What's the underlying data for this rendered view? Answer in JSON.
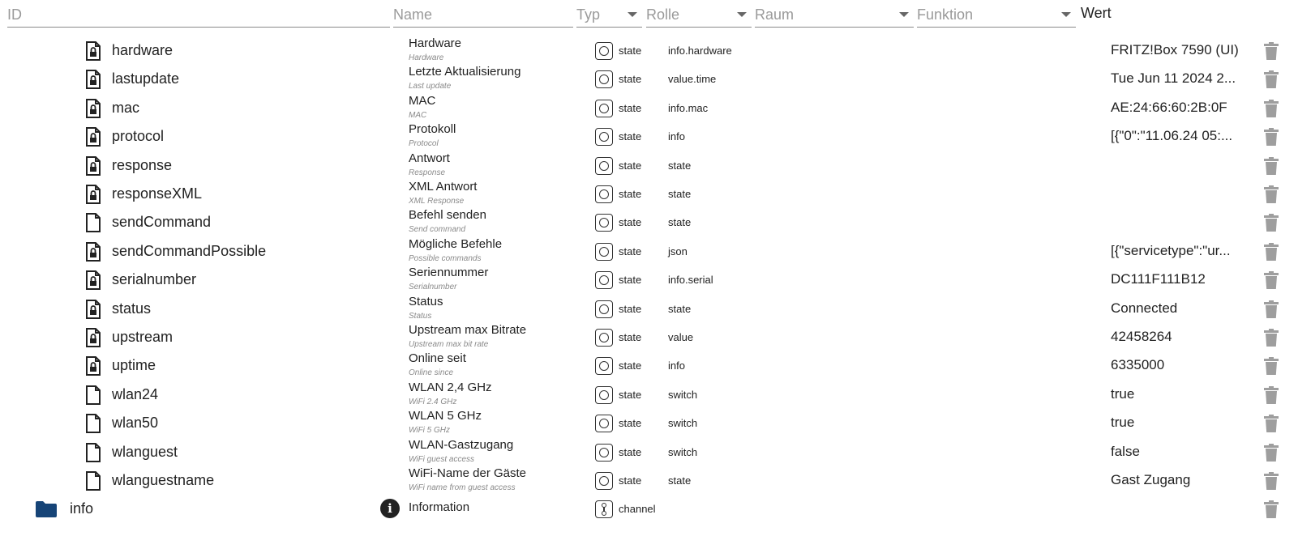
{
  "header": {
    "id_placeholder": "ID",
    "name_placeholder": "Name",
    "type_placeholder": "Typ",
    "role_placeholder": "Rolle",
    "room_placeholder": "Raum",
    "function_placeholder": "Funktion",
    "value_label": "Wert"
  },
  "colors": {
    "folder": "#164477",
    "icon": "#222222",
    "trash": "#9e9e9e"
  },
  "rows": [
    {
      "id": "hardware",
      "icon": "file-lock-icon",
      "name": "Hardware",
      "name_sub": "Hardware",
      "type": "state",
      "role": "info.hardware",
      "value": "FRITZ!Box 7590 (UI)"
    },
    {
      "id": "lastupdate",
      "icon": "file-lock-icon",
      "name": "Letzte Aktualisierung",
      "name_sub": "Last update",
      "type": "state",
      "role": "value.time",
      "value": "Tue Jun 11 2024 2..."
    },
    {
      "id": "mac",
      "icon": "file-lock-icon",
      "name": "MAC",
      "name_sub": "MAC",
      "type": "state",
      "role": "info.mac",
      "value": "AE:24:66:60:2B:0F"
    },
    {
      "id": "protocol",
      "icon": "file-lock-icon",
      "name": "Protokoll",
      "name_sub": "Protocol",
      "type": "state",
      "role": "info",
      "value": "[{\"0\":\"11.06.24 05:..."
    },
    {
      "id": "response",
      "icon": "file-lock-icon",
      "name": "Antwort",
      "name_sub": "Response",
      "type": "state",
      "role": "state",
      "value": ""
    },
    {
      "id": "responseXML",
      "icon": "file-lock-icon",
      "name": "XML Antwort",
      "name_sub": "XML Response",
      "type": "state",
      "role": "state",
      "value": ""
    },
    {
      "id": "sendCommand",
      "icon": "file-icon",
      "name": "Befehl senden",
      "name_sub": "Send command",
      "type": "state",
      "role": "state",
      "value": ""
    },
    {
      "id": "sendCommandPossible",
      "icon": "file-lock-icon",
      "name": "Mögliche Befehle",
      "name_sub": "Possible commands",
      "type": "state",
      "role": "json",
      "value": "[{\"servicetype\":\"ur..."
    },
    {
      "id": "serialnumber",
      "icon": "file-lock-icon",
      "name": "Seriennummer",
      "name_sub": "Serialnumber",
      "type": "state",
      "role": "info.serial",
      "value": "DC111F111B12"
    },
    {
      "id": "status",
      "icon": "file-lock-icon",
      "name": "Status",
      "name_sub": "Status",
      "type": "state",
      "role": "state",
      "value": "Connected"
    },
    {
      "id": "upstream",
      "icon": "file-lock-icon",
      "name": "Upstream max Bitrate",
      "name_sub": "Upstream max bit rate",
      "type": "state",
      "role": "value",
      "value": "42458264"
    },
    {
      "id": "uptime",
      "icon": "file-lock-icon",
      "name": "Online seit",
      "name_sub": "Online since",
      "type": "state",
      "role": "info",
      "value": "6335000"
    },
    {
      "id": "wlan24",
      "icon": "file-icon",
      "name": "WLAN 2,4 GHz",
      "name_sub": "WiFi 2.4 GHz",
      "type": "state",
      "role": "switch",
      "value": "true"
    },
    {
      "id": "wlan50",
      "icon": "file-icon",
      "name": "WLAN 5 GHz",
      "name_sub": "WiFi 5 GHz",
      "type": "state",
      "role": "switch",
      "value": "true"
    },
    {
      "id": "wlanguest",
      "icon": "file-icon",
      "name": "WLAN-Gastzugang",
      "name_sub": "WiFi guest access",
      "type": "state",
      "role": "switch",
      "value": "false"
    },
    {
      "id": "wlanguestname",
      "icon": "file-icon",
      "name": "WiFi-Name der Gäste",
      "name_sub": "WiFi name from guest access",
      "type": "state",
      "role": "state",
      "value": "Gast Zugang"
    },
    {
      "id": "info",
      "icon": "folder-icon",
      "name": "Information",
      "name_sub": "",
      "type": "channel",
      "role": "",
      "value": "",
      "folder": true
    }
  ]
}
